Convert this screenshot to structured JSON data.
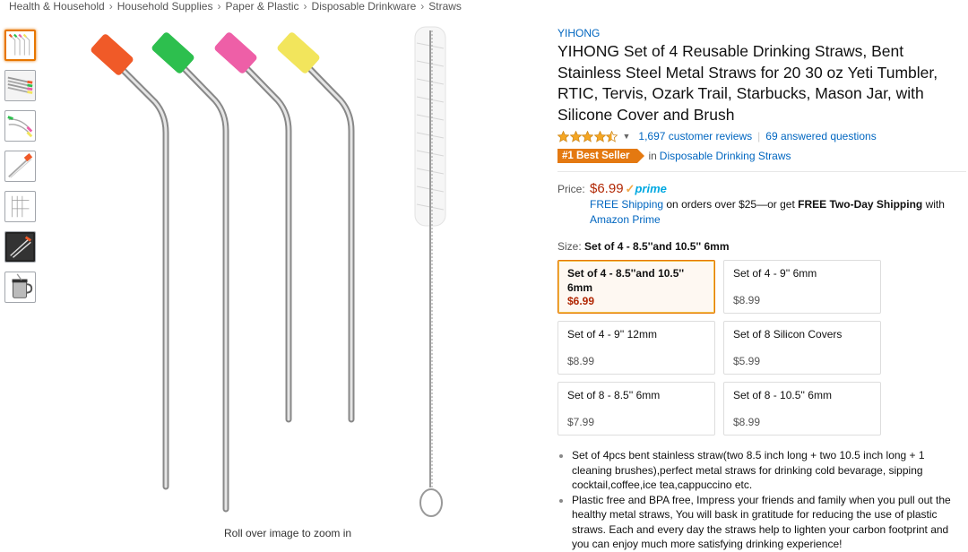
{
  "breadcrumb": [
    "Health & Household",
    "Household Supplies",
    "Paper & Plastic",
    "Disposable Drinkware",
    "Straws"
  ],
  "breadcrumb_sep": "›",
  "zoom_hint": "Roll over image to zoom in",
  "product": {
    "brand": "YIHONG",
    "title": "YIHONG Set of 4 Reusable Drinking Straws, Bent Stainless Steel Metal Straws for 20 30 oz Yeti Tumbler, RTIC, Tervis, Ozark Trail, Starbucks, Mason Jar, with Silicone Cover and Brush",
    "rating_stars": 4.5,
    "reviews": "1,697 customer reviews",
    "answered": "69 answered questions",
    "best_seller": {
      "rank": "#1",
      "label": "Best Seller",
      "in": "in",
      "category": "Disposable Drinking Straws"
    }
  },
  "price": {
    "label": "Price:",
    "amount": "$6.99",
    "prime_check": "✓",
    "prime": "prime",
    "free_shipping": "FREE Shipping",
    "ship_mid": " on orders over $25—or get ",
    "two_day": "FREE Two-Day Shipping",
    "ship_with": " with",
    "amazon_prime": "Amazon Prime"
  },
  "size": {
    "label": "Size:",
    "selected": "Set of 4 - 8.5''and 10.5'' 6mm",
    "options": [
      {
        "name": "Set of 4 - 8.5''and 10.5'' 6mm",
        "price": "$6.99",
        "selected": true
      },
      {
        "name": "Set of 4 - 9'' 6mm",
        "price": "$8.99"
      },
      {
        "name": "Set of 4 - 9'' 12mm",
        "price": "$8.99"
      },
      {
        "name": "Set of 8 Silicon Covers",
        "price": "$5.99"
      },
      {
        "name": "Set of 8 - 8.5'' 6mm",
        "price": "$7.99"
      },
      {
        "name": "Set of 8 - 10.5'' 6mm",
        "price": "$8.99"
      }
    ]
  },
  "bullets": [
    "Set of 4pcs bent stainless straw(two 8.5 inch long + two 10.5 inch long + 1 cleaning brushes),perfect metal straws for drinking cold bevarage, sipping cocktail,coffee,ice tea,cappuccino etc.",
    "Plastic free and BPA free, Impress your friends and family when you pull out the healthy metal straws, You will bask in gratitude for reducing the use of plastic straws. Each and every day the straws help to lighten your carbon footprint and you can enjoy much more satisfying drinking experience!"
  ],
  "colors": {
    "link": "#0066c0",
    "price": "#b12704",
    "badge": "#e47911",
    "selected_border": "#e77600",
    "straw_tips": [
      "#f05a28",
      "#2dbf4e",
      "#ee5fa7",
      "#f2e55c"
    ]
  }
}
